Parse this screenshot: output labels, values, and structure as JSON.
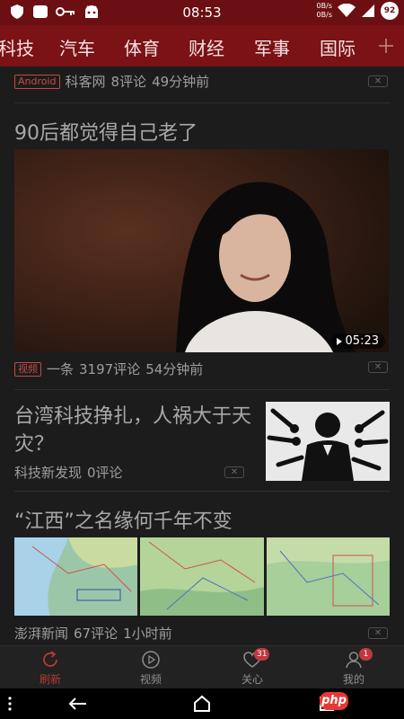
{
  "status_bar": {
    "time": "08:53",
    "net_up": "0B/s",
    "net_down": "0B/s",
    "battery": "92",
    "icons": [
      "shield-icon",
      "briefcase-icon",
      "key-icon",
      "android-icon",
      "wifi-icon",
      "signal-icon"
    ]
  },
  "nav": {
    "categories": [
      "科技",
      "汽车",
      "体育",
      "财经",
      "军事",
      "国际"
    ],
    "add_icon": "plus-icon"
  },
  "feed": {
    "item0": {
      "tag": "Android",
      "source": "科客网",
      "comments": "8评论",
      "time": "49分钟前"
    },
    "item1": {
      "title": "90后都觉得自己老了",
      "duration": "05:23",
      "tag": "视频",
      "source": "一条",
      "comments": "3197评论",
      "time": "54分钟前"
    },
    "item2": {
      "title": "台湾科技挣扎，人祸大于天灾？",
      "source": "科技新发现",
      "comments": "0评论"
    },
    "item3": {
      "title": "“江西”之名缘何千年不变",
      "source": "澎湃新闻",
      "comments": "67评论",
      "time": "1小时前"
    },
    "dismiss_label": "✕"
  },
  "tabs": [
    {
      "label": "刷新",
      "icon": "refresh-icon",
      "active": true
    },
    {
      "label": "视频",
      "icon": "play-circle-icon"
    },
    {
      "label": "关心",
      "icon": "heart-icon",
      "badge": "31"
    },
    {
      "label": "我的",
      "icon": "person-icon",
      "badge": "1"
    }
  ],
  "system_nav": {
    "icons": [
      "more-icon",
      "back-icon",
      "home-icon",
      "recents-icon"
    ],
    "watermark": "php"
  },
  "colors": {
    "brand_red": "#7a1216",
    "status_red": "#6b0f12",
    "active_tab": "#b43a35",
    "background": "#1c1c1c"
  }
}
